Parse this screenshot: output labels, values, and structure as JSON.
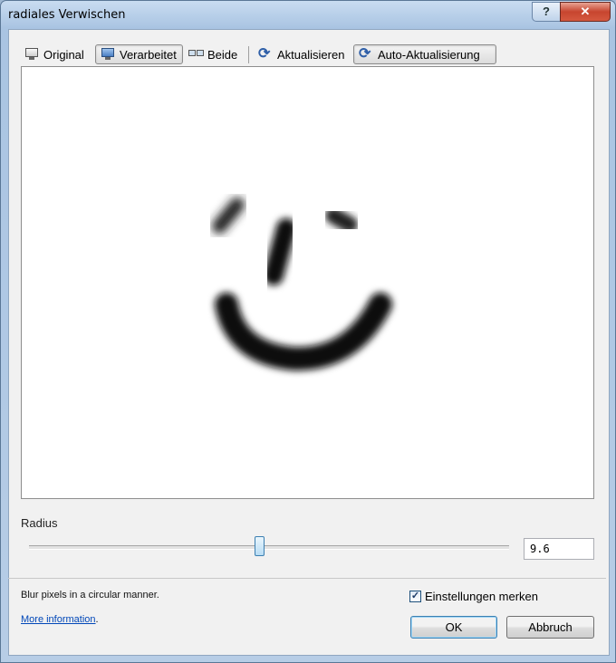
{
  "window": {
    "title": "radiales Verwischen",
    "help_label": "?",
    "close_label": "✕"
  },
  "toolbar": {
    "original_label": "Original",
    "processed_label": "Verarbeitet",
    "both_label": "Beide",
    "refresh_label": "Aktualisieren",
    "auto_refresh_label": "Auto-Aktualisierung",
    "pressed": [
      "Verarbeitet",
      "Auto-Aktualisierung"
    ]
  },
  "radius": {
    "label": "Radius",
    "value": "9.6",
    "slider_fraction": 0.48
  },
  "footer": {
    "description": "Blur pixels in a circular manner.",
    "more_info_label": "More information",
    "more_info_suffix": ".",
    "remember_label": "Einstellungen merken",
    "remember_checked": true,
    "ok_label": "OK",
    "cancel_label": "Abbruch"
  },
  "colors": {
    "accent": "#3c7fb1",
    "link": "#0047b8",
    "close": "#c7452f"
  }
}
